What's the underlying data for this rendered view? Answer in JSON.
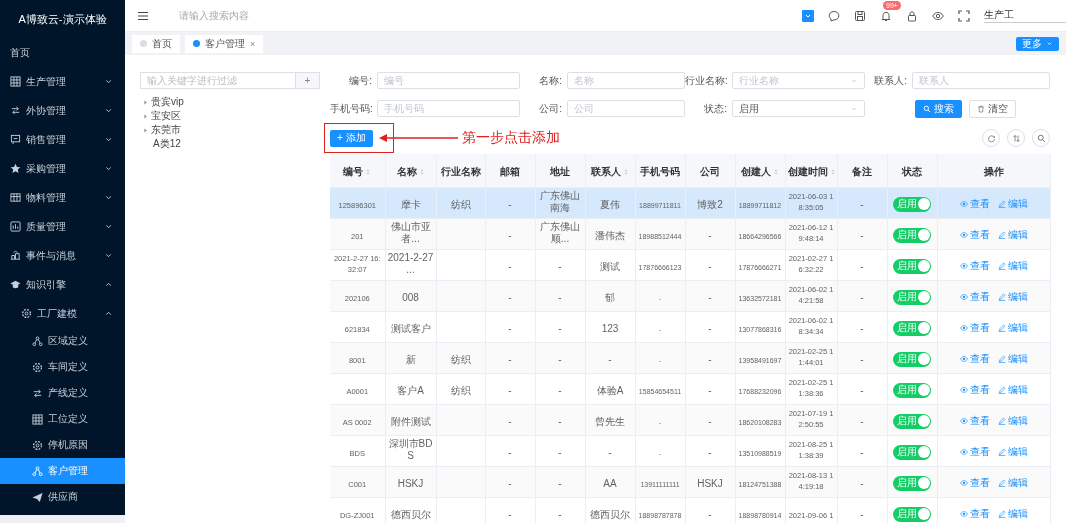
{
  "sidebar": {
    "title": "A博致云-演示体验",
    "items": [
      {
        "label": "首页",
        "selected": false
      },
      {
        "label": "生产管理",
        "expanded": false,
        "selected": false
      },
      {
        "label": "外协管理",
        "expanded": false,
        "selected": false
      },
      {
        "label": "销售管理",
        "expanded": false,
        "selected": false
      },
      {
        "label": "采购管理",
        "expanded": false,
        "selected": false
      },
      {
        "label": "物料管理",
        "expanded": false,
        "selected": false
      },
      {
        "label": "质量管理",
        "expanded": false,
        "selected": false
      },
      {
        "label": "事件与消息",
        "expanded": false,
        "selected": false
      },
      {
        "label": "知识引擎",
        "expanded": true,
        "selected": false,
        "children": [
          {
            "label": "工厂建模",
            "expanded": true,
            "selected": false,
            "children": [
              {
                "label": "区域定义",
                "selected": false
              },
              {
                "label": "车间定义",
                "selected": false
              },
              {
                "label": "产线定义",
                "selected": false
              },
              {
                "label": "工位定义",
                "selected": false
              },
              {
                "label": "停机原因",
                "selected": false
              },
              {
                "label": "客户管理",
                "selected": true
              },
              {
                "label": "供应商",
                "selected": false
              }
            ]
          }
        ]
      }
    ]
  },
  "top_bar": {
    "search": {
      "placeholder": "请输入搜索内容"
    },
    "notification_badge": "99+",
    "user": "生产工"
  },
  "tabs": [
    {
      "label": "首页",
      "selected": false
    },
    {
      "label": "客户管理",
      "selected": true,
      "close": "×"
    }
  ],
  "more_button": "更多",
  "tree": {
    "filter": {
      "placeholder": "输入关键字进行过滤"
    },
    "add_button": "+",
    "nodes": [
      {
        "label": "贵宾vip",
        "kind": "folder",
        "expanded": false
      },
      {
        "label": "宝安区",
        "kind": "folder",
        "expanded": false
      },
      {
        "label": "东莞市",
        "kind": "folder",
        "expanded": false
      },
      {
        "label": "A类12",
        "kind": "leaf"
      }
    ]
  },
  "filters": {
    "fields": [
      {
        "label": "编号:",
        "kind": "input",
        "placeholder": "编号"
      },
      {
        "label": "名称:",
        "kind": "input",
        "placeholder": "名称"
      },
      {
        "label": "行业名称:",
        "kind": "select",
        "placeholder": "行业名称"
      },
      {
        "label": "联系人:",
        "kind": "input",
        "placeholder": "联系人"
      },
      {
        "label": "手机号码:",
        "kind": "input",
        "placeholder": "手机号码"
      },
      {
        "label": "公司:",
        "kind": "input",
        "placeholder": "公司"
      },
      {
        "label": "状态:",
        "kind": "select",
        "value": "启用"
      }
    ],
    "buttons": [
      {
        "label": "搜索",
        "kind": "primary"
      },
      {
        "label": "清空",
        "kind": "default"
      }
    ]
  },
  "toolbar": {
    "add_button": "+ 添加",
    "annotation": "第一步点击添加"
  },
  "table": {
    "columns": [
      {
        "label": "编号",
        "sortable": true
      },
      {
        "label": "名称",
        "sortable": true
      },
      {
        "label": "行业名称",
        "sortable": false
      },
      {
        "label": "邮箱",
        "sortable": false
      },
      {
        "label": "地址",
        "sortable": false
      },
      {
        "label": "联系人",
        "sortable": true
      },
      {
        "label": "手机号码",
        "sortable": false
      },
      {
        "label": "公司",
        "sortable": false
      },
      {
        "label": "创建人",
        "sortable": true
      },
      {
        "label": "创建时间",
        "sortable": true
      },
      {
        "label": "备注",
        "sortable": false
      },
      {
        "label": "状态",
        "sortable": false
      },
      {
        "label": "操作",
        "sortable": false
      }
    ],
    "rows": [
      {
        "selected": true,
        "cells": [
          "125896301",
          "摩卡",
          "纺织",
          "-",
          "广东佛山南海",
          "夏伟",
          "18899711811",
          "博致2",
          "18899711812",
          "2021-06-03 18:35:05",
          "-"
        ],
        "status": {
          "label": "启用",
          "on": true
        },
        "actions": [
          "查看",
          "编辑"
        ]
      },
      {
        "selected": false,
        "cells": [
          "201",
          "佛山市亚者...",
          null,
          "-",
          "广东佛山顺...",
          "潘伟杰",
          "18988512444",
          "-",
          "18664296566",
          "2021-06-12 19:48:14",
          "-"
        ],
        "status": {
          "label": "启用",
          "on": true
        },
        "actions": [
          "查看",
          "编辑"
        ]
      },
      {
        "selected": false,
        "cells": [
          "2021-2-27 16:32:07",
          "2021-2-27 ...",
          null,
          "-",
          "-",
          "测试",
          "17876666123",
          "-",
          "17876666271",
          "2021-02-27 16:32:22",
          "-"
        ],
        "status": {
          "label": "启用",
          "on": true
        },
        "actions": [
          "查看",
          "编辑"
        ]
      },
      {
        "selected": false,
        "cells": [
          "202106",
          "008",
          null,
          "-",
          "-",
          "郁",
          "-",
          "-",
          "13632572181",
          "2021-06-02 14:21:58",
          "-"
        ],
        "status": {
          "label": "启用",
          "on": true
        },
        "actions": [
          "查看",
          "编辑"
        ]
      },
      {
        "selected": false,
        "cells": [
          "621834",
          "测试客户",
          null,
          "-",
          "-",
          "123",
          "-",
          "-",
          "13077868316",
          "2021-06-02 18:34:34",
          "-"
        ],
        "status": {
          "label": "启用",
          "on": true
        },
        "actions": [
          "查看",
          "编辑"
        ]
      },
      {
        "selected": false,
        "cells": [
          "8001",
          "新",
          "纺织",
          "-",
          "-",
          "-",
          "-",
          "-",
          "13958491697",
          "2021-02-25 11:44:01",
          "-"
        ],
        "status": {
          "label": "启用",
          "on": true
        },
        "actions": [
          "查看",
          "编辑"
        ]
      },
      {
        "selected": false,
        "cells": [
          "A0001",
          "客户A",
          "纺织",
          "-",
          "-",
          "体验A",
          "15854654511",
          "-",
          "17688232096",
          "2021-02-25 11:38:36",
          "-"
        ],
        "status": {
          "label": "启用",
          "on": true
        },
        "actions": [
          "查看",
          "编辑"
        ]
      },
      {
        "selected": false,
        "cells": [
          "AS 0002",
          "附件测试",
          null,
          "-",
          "-",
          "曾先生",
          "-",
          "-",
          "18620108283",
          "2021-07-19 12:50:55",
          "-"
        ],
        "status": {
          "label": "启用",
          "on": true
        },
        "actions": [
          "查看",
          "编辑"
        ]
      },
      {
        "selected": false,
        "cells": [
          "BDS",
          "深圳市BDS",
          null,
          "-",
          "-",
          "-",
          "-",
          "-",
          "13510988519",
          "2021-08-25 11:38:39",
          "-"
        ],
        "status": {
          "label": "启用",
          "on": true
        },
        "actions": [
          "查看",
          "编辑"
        ]
      },
      {
        "selected": false,
        "cells": [
          "C001",
          "HSKJ",
          null,
          "-",
          "-",
          "AA",
          "13911111111",
          "HSKJ",
          "18124751388",
          "2021-08-13 14:19:18",
          "-"
        ],
        "status": {
          "label": "启用",
          "on": true
        },
        "actions": [
          "查看",
          "编辑"
        ]
      },
      {
        "selected": false,
        "cells": [
          "DG-ZJ001",
          "德西贝尔",
          null,
          "-",
          "-",
          "德西贝尔",
          "18898787878",
          "-",
          "18898780914",
          "2021-09-06 1",
          "-"
        ],
        "status": {
          "label": "启用",
          "on": true
        },
        "actions": [
          "查看",
          "编辑"
        ]
      }
    ]
  }
}
